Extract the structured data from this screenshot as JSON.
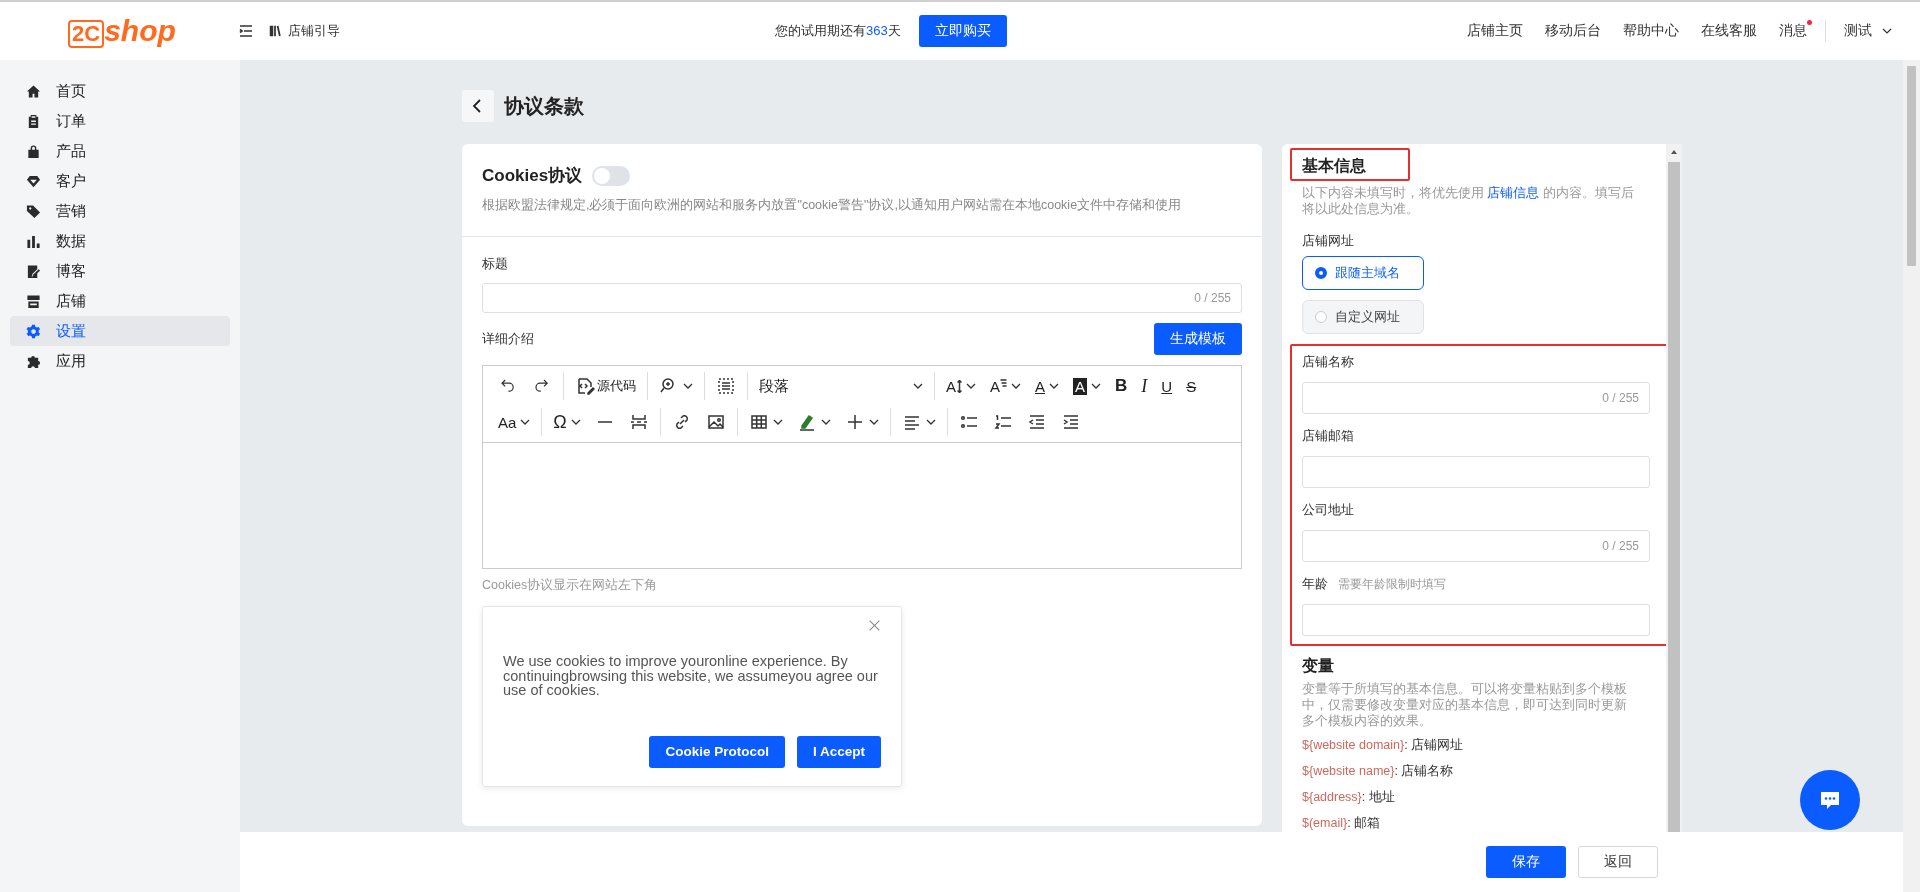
{
  "topbar": {
    "logo": {
      "mark": "2C",
      "word": "shop"
    },
    "guide": "店铺引导",
    "trial": {
      "prefix": "您的试用期还有",
      "days": "363",
      "suffix": "天"
    },
    "buy_button": "立即购买",
    "links": [
      "店铺主页",
      "移动后台",
      "帮助中心",
      "在线客服"
    ],
    "messages": {
      "label": "消息",
      "unread": true
    },
    "user": "测试"
  },
  "sidebar": {
    "items": [
      {
        "label": "首页",
        "kind": "home",
        "selected": false
      },
      {
        "label": "订单",
        "kind": "order",
        "selected": false
      },
      {
        "label": "产品",
        "kind": "product",
        "selected": false
      },
      {
        "label": "客户",
        "kind": "customer",
        "selected": false
      },
      {
        "label": "营销",
        "kind": "marketing",
        "selected": false
      },
      {
        "label": "数据",
        "kind": "data",
        "selected": false
      },
      {
        "label": "博客",
        "kind": "blog",
        "selected": false
      },
      {
        "label": "店铺",
        "kind": "store",
        "selected": false
      },
      {
        "label": "设置",
        "kind": "settings",
        "selected": true
      },
      {
        "label": "应用",
        "kind": "apps",
        "selected": false
      }
    ]
  },
  "page": {
    "title": "协议条款"
  },
  "cookie_card": {
    "title": "Cookies协议",
    "enabled": false,
    "description": "根据欧盟法律规定,必须于面向欧洲的网站和服务内放置\"cookie警告\"协议,以通知用户网站需在本地cookie文件中存储和使用",
    "title_field": {
      "label": "标题",
      "counter": "0 / 255"
    },
    "detail": {
      "label": "详细介绍",
      "button": "生成模板"
    },
    "toolbar": [
      [
        [
          {
            "kind": "undo",
            "dropdown": false
          },
          {
            "kind": "redo",
            "dropdown": false
          }
        ],
        [
          {
            "kind": "source",
            "label": "源代码",
            "dropdown": false
          }
        ],
        [
          {
            "kind": "find",
            "dropdown": true
          }
        ],
        [
          {
            "kind": "select-all",
            "dropdown": false
          }
        ],
        [
          {
            "kind": "block-format",
            "label": "段落",
            "dropdown": true
          }
        ],
        [
          {
            "kind": "font-size",
            "label": "A",
            "dropdown": true
          },
          {
            "kind": "line-height",
            "label": "A",
            "dropdown": true
          },
          {
            "kind": "font-color",
            "label": "A",
            "dropdown": true
          },
          {
            "kind": "bg-color",
            "label": "A",
            "dropdown": true
          },
          {
            "kind": "bold",
            "label": "B",
            "dropdown": false
          },
          {
            "kind": "italic",
            "label": "I",
            "dropdown": false
          },
          {
            "kind": "underline",
            "label": "U",
            "dropdown": false
          },
          {
            "kind": "strike",
            "label": "S",
            "dropdown": false
          }
        ]
      ],
      [
        [
          {
            "kind": "font-family",
            "label": "Aa",
            "dropdown": true
          }
        ],
        [
          {
            "kind": "special-char",
            "label": "Ω",
            "dropdown": true
          },
          {
            "kind": "hr",
            "dropdown": false
          },
          {
            "kind": "page-break",
            "dropdown": false
          }
        ],
        [
          {
            "kind": "link",
            "dropdown": false
          },
          {
            "kind": "image",
            "dropdown": false
          }
        ],
        [
          {
            "kind": "table",
            "dropdown": true
          },
          {
            "kind": "highlight",
            "dropdown": true
          },
          {
            "kind": "insert",
            "dropdown": true
          }
        ],
        [
          {
            "kind": "align",
            "dropdown": true
          }
        ],
        [
          {
            "kind": "bullet-list",
            "dropdown": false
          },
          {
            "kind": "number-list",
            "dropdown": false
          },
          {
            "kind": "outdent",
            "dropdown": false
          },
          {
            "kind": "indent",
            "dropdown": false
          }
        ]
      ]
    ],
    "hint": "Cookies协议显示在网站左下角",
    "preview": {
      "text": "We use cookies to improve youronline experience. By continuingbrowsing this website, we assumeyou agree our use of cookies.",
      "buttons": [
        "Cookie Protocol",
        "I Accept"
      ]
    }
  },
  "info_panel": {
    "title": "基本信息",
    "title_highlighted": true,
    "description_before": "以下内容未填写时，将优先使用 ",
    "description_link": "店铺信息",
    "description_after": " 的内容。填写后将以此处信息为准。",
    "url_label": "店铺网址",
    "url_options": [
      {
        "label": "跟随主域名",
        "selected": true
      },
      {
        "label": "自定义网址",
        "selected": false
      }
    ],
    "fields_highlighted": true,
    "fields": [
      {
        "label": "店铺名称",
        "counter": "0 / 255"
      },
      {
        "label": "店铺邮箱"
      },
      {
        "label": "公司地址",
        "counter": "0 / 255"
      },
      {
        "label": "年龄",
        "hint": "需要年龄限制时填写"
      }
    ],
    "variables_title": "变量",
    "variables_description": "变量等于所填写的基本信息。可以将变量粘贴到多个模板中，仅需要修改变量对应的基本信息，即可达到同时更新多个模板内容的效果。",
    "variables": [
      {
        "token": "${website domain}",
        "meaning": ": 店铺网址"
      },
      {
        "token": "${website name}",
        "meaning": ": 店铺名称"
      },
      {
        "token": "${address}",
        "meaning": ": 地址"
      },
      {
        "token": "$(email}",
        "meaning": ": 邮箱"
      }
    ]
  },
  "footer": {
    "save": "保存",
    "back": "返回"
  }
}
